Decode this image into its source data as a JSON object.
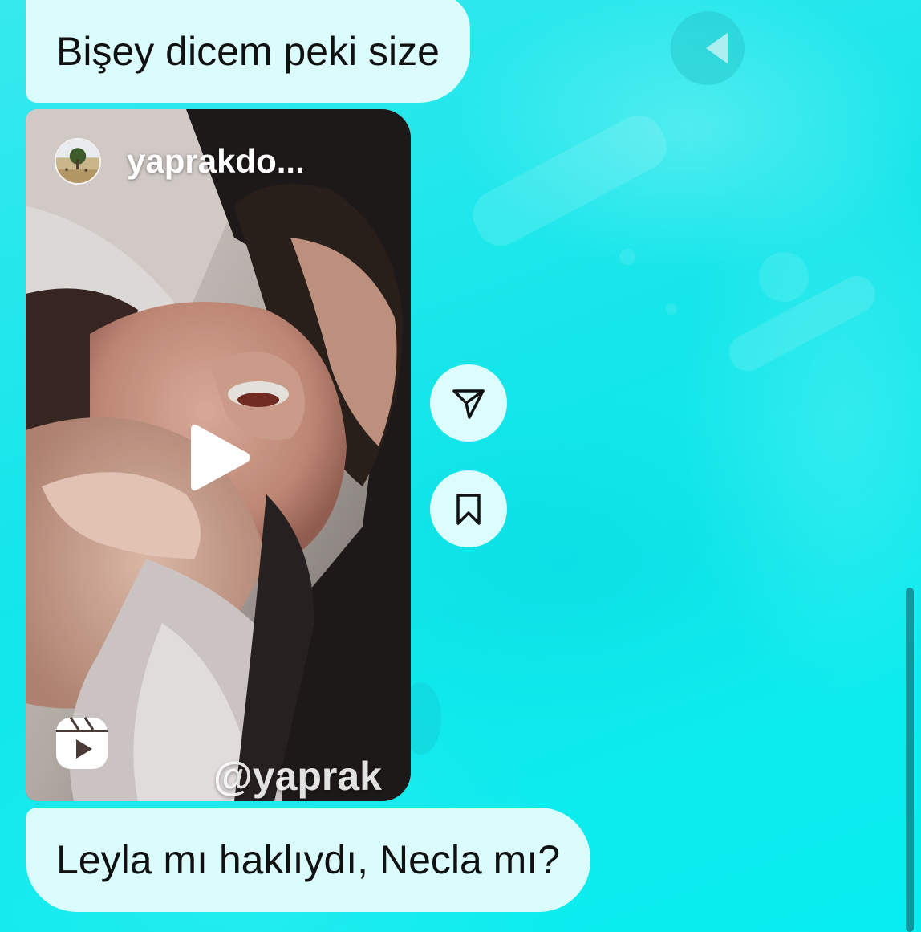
{
  "messages": [
    {
      "text": "Bişey dicem peki size"
    },
    {
      "text": "Leyla mı haklıydı, Necla mı?"
    }
  ],
  "reel": {
    "username": "yaprakdo...",
    "watermark": "@yaprak"
  },
  "icons": {
    "play": "play-icon",
    "reels": "reels-icon",
    "share": "send-icon",
    "save": "bookmark-icon"
  },
  "colors": {
    "chat_background": "#12eaea",
    "bubble": "#dafcfd",
    "action_button": "#dcfcfd"
  }
}
